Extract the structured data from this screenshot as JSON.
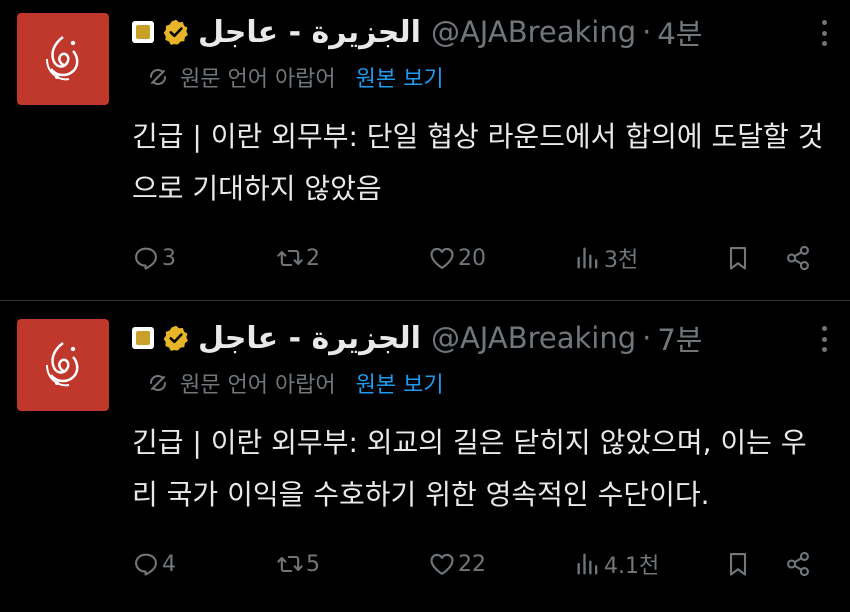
{
  "colors": {
    "background": "#000000",
    "avatar": "#c0372c",
    "verified_badge": "#e8b528",
    "link": "#1d9bf0",
    "muted": "#71767b",
    "text": "#e7e9ea"
  },
  "tweets": [
    {
      "display_name": "الجزيرة - عاجل",
      "handle": "@AJABreaking",
      "separator": "·",
      "time": "4분",
      "translation_note": "원문 언어 아랍어",
      "show_original": "원본 보기",
      "text": "긴급 | 이란 외무부: 단일 협상 라운드에서 합의에 도달할 것으로 기대하지 않았음",
      "stats": {
        "replies": "3",
        "retweets": "2",
        "likes": "20",
        "views": "3천"
      }
    },
    {
      "display_name": "الجزيرة - عاجل",
      "handle": "@AJABreaking",
      "separator": "·",
      "time": "7분",
      "translation_note": "원문 언어 아랍어",
      "show_original": "원본 보기",
      "text": "긴급 | 이란 외무부: 외교의 길은 닫히지 않았으며, 이는 우리 국가 이익을 수호하기 위한 영속적인 수단이다.",
      "stats": {
        "replies": "4",
        "retweets": "5",
        "likes": "22",
        "views": "4.1천"
      }
    }
  ]
}
